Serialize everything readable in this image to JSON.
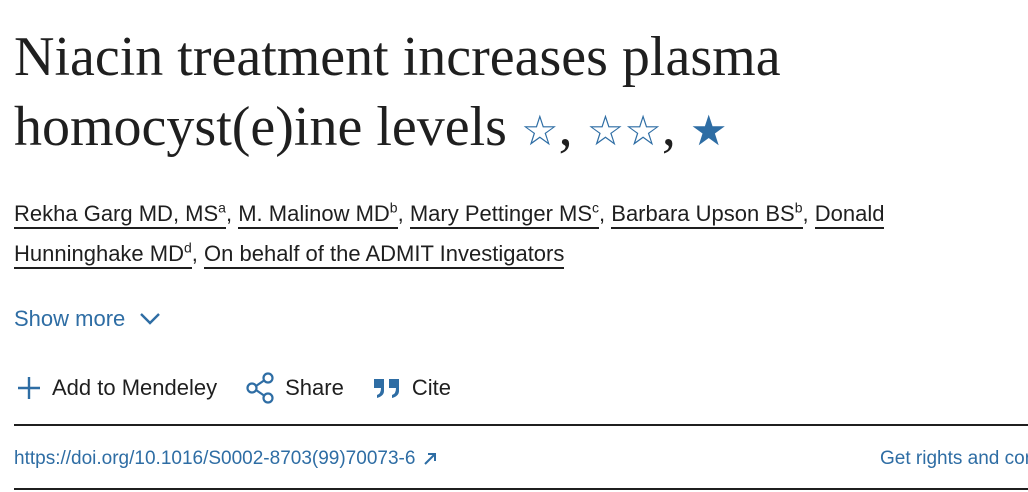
{
  "article": {
    "title_line1": "Niacin treatment increases plasma",
    "title_line2": "homocyst(e)ine levels",
    "title_marks": [
      "☆",
      "☆☆",
      "★"
    ],
    "title_mark_separator": ","
  },
  "authors": [
    {
      "name": "Rekha Garg MD, MS",
      "sup": "a"
    },
    {
      "name": "M. Malinow MD",
      "sup": "b"
    },
    {
      "name": "Mary Pettinger MS",
      "sup": "c"
    },
    {
      "name": "Barbara Upson BS",
      "sup": "b"
    },
    {
      "name_part1": "Donald",
      "name_part2": "Hunninghake MD",
      "sup": "d"
    },
    {
      "name": "On behalf of the ADMIT Investigators"
    }
  ],
  "author_separator": ",",
  "show_more": {
    "label": "Show more"
  },
  "actions": {
    "mendeley_label": "Add to Mendeley",
    "share_label": "Share",
    "cite_label": "Cite"
  },
  "doi": {
    "url": "https://doi.org/10.1016/S0002-8703(99)70073-6",
    "icon": "external-link-arrow-icon"
  },
  "rights": {
    "label": "Get rights and content"
  },
  "colors": {
    "link": "#2e6da4",
    "text": "#1f1f1f"
  }
}
